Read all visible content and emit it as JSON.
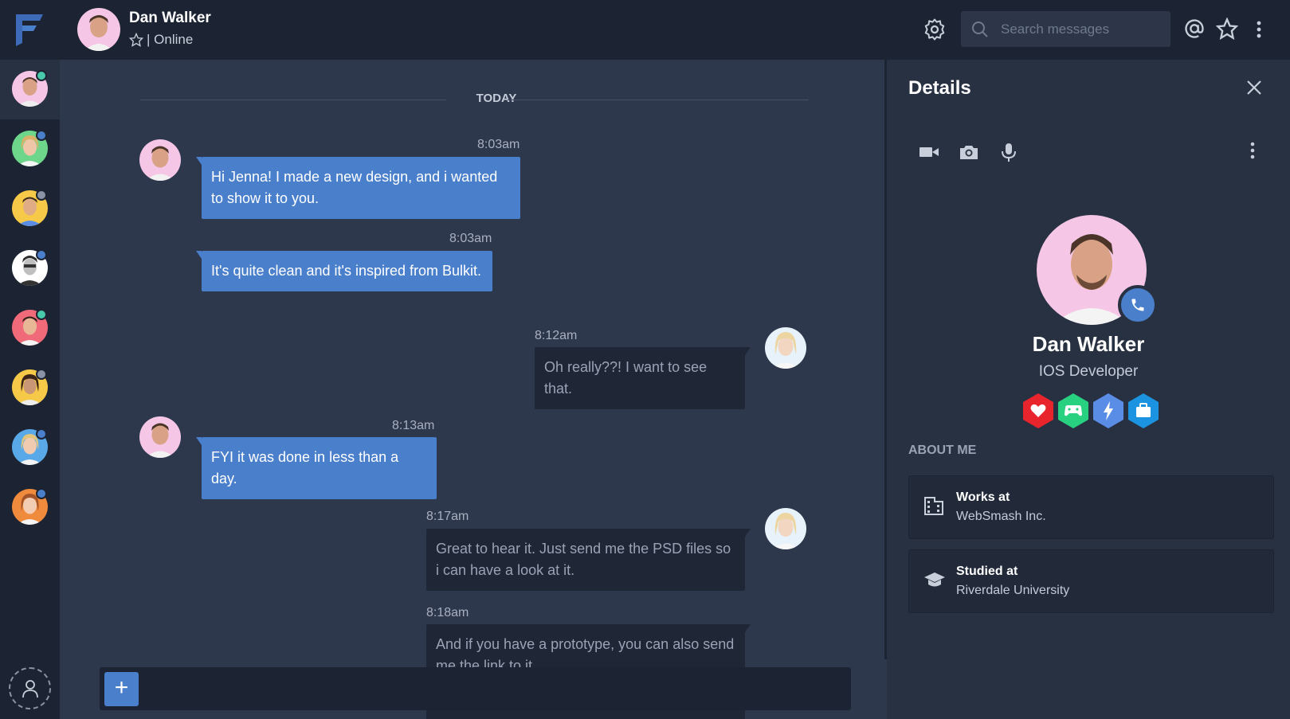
{
  "header": {
    "contact_name": "Dan Walker",
    "status_text": "| Online",
    "search_placeholder": "Search messages"
  },
  "rail": {
    "contacts": [
      {
        "name": "Dan Walker",
        "dot_color": "#48c9a9",
        "bg": "#f5c6e6"
      },
      {
        "name": "contact-2",
        "dot_color": "#4a7fcc",
        "bg": "#6ed68a"
      },
      {
        "name": "contact-3",
        "dot_color": "#8a93a6",
        "bg": "#f7c948"
      },
      {
        "name": "contact-4",
        "dot_color": "#4a7fcc",
        "bg": "#ffffff"
      },
      {
        "name": "contact-5",
        "dot_color": "#48c9a9",
        "bg": "#f06a7a"
      },
      {
        "name": "contact-6",
        "dot_color": "#8a93a6",
        "bg": "#f7c948"
      },
      {
        "name": "contact-7",
        "dot_color": "#4a7fcc",
        "bg": "#59a9e8"
      },
      {
        "name": "contact-8",
        "dot_color": "#4a7fcc",
        "bg": "#f08a3c"
      }
    ]
  },
  "chat": {
    "day_label": "TODAY",
    "messages": [
      {
        "time": "8:03am",
        "text": "Hi Jenna! I made a new design, and i wanted to show it to you."
      },
      {
        "time": "8:03am",
        "text": "It's quite clean and it's inspired from Bulkit."
      },
      {
        "time": "8:12am",
        "text": "Oh really??! I want to see that."
      },
      {
        "time": "8:13am",
        "text": "FYI it was done in less than a day."
      },
      {
        "time": "8:17am",
        "text": "Great to hear it. Just send me the PSD files so i can have a look at it."
      },
      {
        "time": "8:18am",
        "text": "And if you have a prototype, you can also send me the link to it."
      }
    ],
    "composer_plus": "+"
  },
  "details": {
    "title": "Details",
    "profile_name": "Dan Walker",
    "profile_role": "IOS Developer",
    "about_label": "ABOUT ME",
    "works_title": "Works at",
    "works_value": "WebSmash Inc.",
    "studied_title": "Studied at",
    "studied_value": "Riverdale University"
  },
  "colors": {
    "accent": "#4a7fcc",
    "badge_red": "#e8242c",
    "badge_green": "#27d17f",
    "badge_blue": "#5a8ee6",
    "badge_cyan": "#1b93e0"
  }
}
